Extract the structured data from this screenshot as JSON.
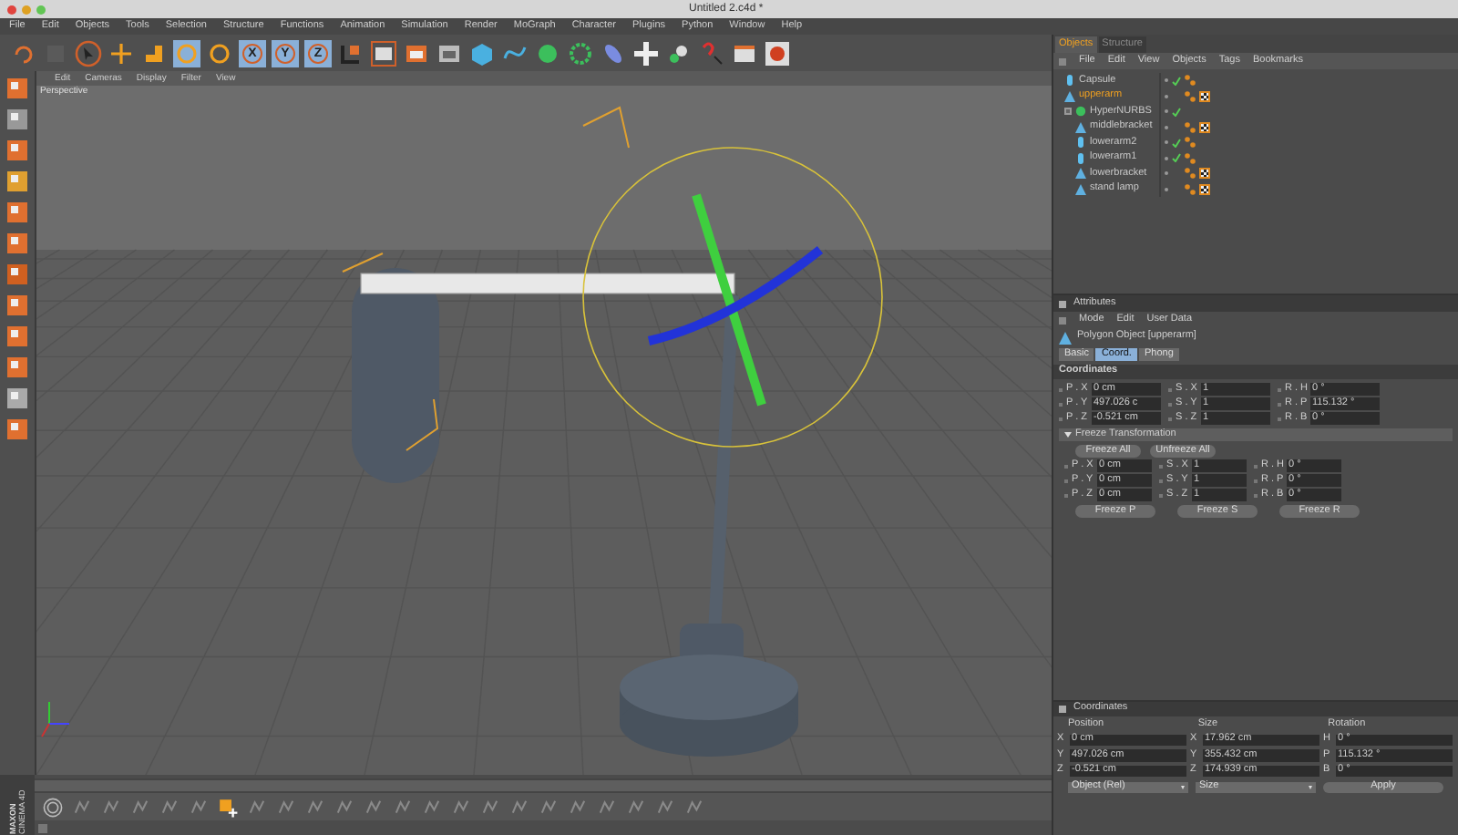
{
  "window": {
    "title": "Untitled 2.c4d *"
  },
  "menu_bar": [
    "File",
    "Edit",
    "Objects",
    "Tools",
    "Selection",
    "Structure",
    "Functions",
    "Animation",
    "Simulation",
    "Render",
    "MoGraph",
    "Character",
    "Plugins",
    "Python",
    "Window",
    "Help"
  ],
  "toolbar": {
    "axis_buttons": [
      {
        "label": "X",
        "selected": true
      },
      {
        "label": "Y",
        "selected": true
      },
      {
        "label": "Z",
        "selected": true
      }
    ]
  },
  "viewport": {
    "menu": [
      "Edit",
      "Cameras",
      "Display",
      "Filter",
      "View"
    ],
    "label": "Perspective"
  },
  "object_manager": {
    "tabs": [
      {
        "label": "Objects",
        "selected": true
      },
      {
        "label": "Structure",
        "selected": false
      }
    ],
    "menu": [
      "File",
      "Edit",
      "View",
      "Objects",
      "Tags",
      "Bookmarks"
    ],
    "objects": [
      {
        "name": "Capsule",
        "kind": "primitive",
        "selected": false,
        "enabled": true,
        "phong_tag": true,
        "texture_tag": false
      },
      {
        "name": "upperarm",
        "kind": "polygon",
        "selected": true,
        "enabled": false,
        "phong_tag": true,
        "texture_tag": true
      },
      {
        "name": "HyperNURBS",
        "kind": "nurbs",
        "selected": false,
        "enabled": true,
        "expanded": true,
        "phong_tag": false,
        "texture_tag": false,
        "children": [
          {
            "name": "middlebracket",
            "kind": "polygon",
            "selected": false,
            "enabled": false,
            "phong_tag": true,
            "texture_tag": true
          },
          {
            "name": "lowerarm2",
            "kind": "primitive",
            "selected": false,
            "enabled": true,
            "phong_tag": true,
            "texture_tag": false
          },
          {
            "name": "lowerarm1",
            "kind": "primitive",
            "selected": false,
            "enabled": true,
            "phong_tag": true,
            "texture_tag": false
          },
          {
            "name": "lowerbracket",
            "kind": "polygon",
            "selected": false,
            "enabled": false,
            "phong_tag": true,
            "texture_tag": true
          },
          {
            "name": "stand lamp",
            "kind": "polygon",
            "selected": false,
            "enabled": false,
            "phong_tag": true,
            "texture_tag": true
          }
        ]
      }
    ]
  },
  "attributes": {
    "title": "Attributes",
    "menu": [
      "Mode",
      "Edit",
      "User Data"
    ],
    "object_title": "Polygon Object [upperarm]",
    "tabs": [
      {
        "label": "Basic",
        "selected": false
      },
      {
        "label": "Coord.",
        "selected": true
      },
      {
        "label": "Phong",
        "selected": false
      }
    ],
    "section": "Coordinates",
    "fields": [
      [
        {
          "label": "P . X",
          "value": "0 cm"
        },
        {
          "label": "S . X",
          "value": "1"
        },
        {
          "label": "R . H",
          "value": "0 °"
        }
      ],
      [
        {
          "label": "P . Y",
          "value": "497.026 c"
        },
        {
          "label": "S . Y",
          "value": "1"
        },
        {
          "label": "R . P",
          "value": "115.132 °"
        }
      ],
      [
        {
          "label": "P . Z",
          "value": "-0.521 cm"
        },
        {
          "label": "S . Z",
          "value": "1"
        },
        {
          "label": "R . B",
          "value": "0 °"
        }
      ]
    ],
    "freeze": {
      "title": "Freeze Transformation",
      "expanded": true,
      "buttons_top": [
        "Freeze All",
        "Unfreeze All"
      ],
      "fields": [
        [
          {
            "label": "P . X",
            "value": "0 cm"
          },
          {
            "label": "S . X",
            "value": "1"
          },
          {
            "label": "R . H",
            "value": "0 °"
          }
        ],
        [
          {
            "label": "P . Y",
            "value": "0 cm"
          },
          {
            "label": "S . Y",
            "value": "1"
          },
          {
            "label": "R . P",
            "value": "0 °"
          }
        ],
        [
          {
            "label": "P . Z",
            "value": "0 cm"
          },
          {
            "label": "S . Z",
            "value": "1"
          },
          {
            "label": "R . B",
            "value": "0 °"
          }
        ]
      ],
      "buttons_bottom": [
        "Freeze P",
        "Freeze S",
        "Freeze R"
      ]
    }
  },
  "coordinates": {
    "title": "Coordinates",
    "headers": [
      "Position",
      "Size",
      "Rotation"
    ],
    "rows": [
      [
        {
          "label": "X",
          "value": "0 cm"
        },
        {
          "label": "X",
          "value": "17.962 cm"
        },
        {
          "label": "H",
          "value": "0 °"
        }
      ],
      [
        {
          "label": "Y",
          "value": "497.026 cm"
        },
        {
          "label": "Y",
          "value": "355.432 cm"
        },
        {
          "label": "P",
          "value": "115.132 °"
        }
      ],
      [
        {
          "label": "Z",
          "value": "-0.521 cm"
        },
        {
          "label": "Z",
          "value": "174.939 cm"
        },
        {
          "label": "B",
          "value": "0 °"
        }
      ]
    ],
    "dropdowns": [
      "Object (Rel)",
      "Size"
    ],
    "apply": "Apply"
  },
  "logo": {
    "line_1": "MAXON",
    "line_2": "CINEMA 4D"
  }
}
